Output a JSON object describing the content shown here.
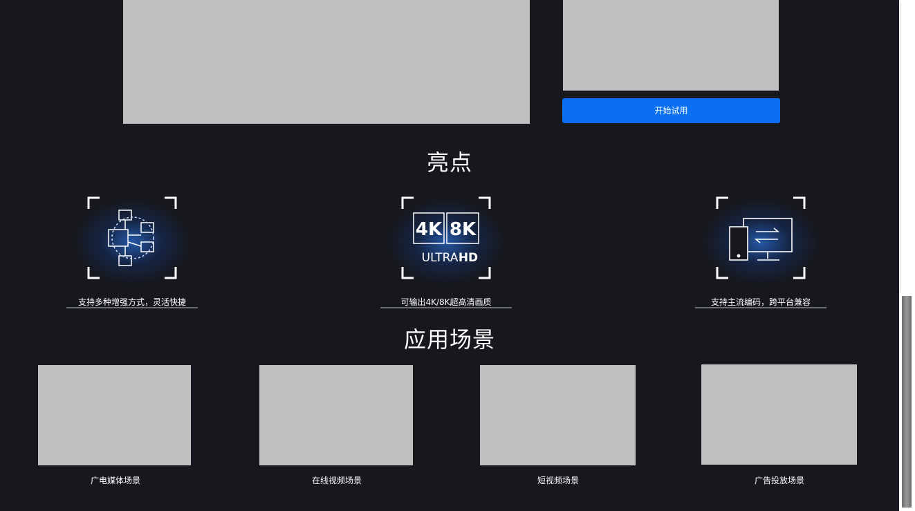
{
  "top": {
    "trial_button": "开始试用"
  },
  "highlights": {
    "title": "亮点",
    "items": [
      {
        "icon": "workflow-diagram-icon",
        "caption": "支持多种增强方式，灵活快捷"
      },
      {
        "icon": "4k-8k-ultrahd-icon",
        "caption": "可输出4K/8K超高清画质",
        "badge_4k": "4K",
        "badge_8k": "8K",
        "badge_ultra": "ULTRA",
        "badge_hd": "HD"
      },
      {
        "icon": "device-sync-icon",
        "caption": "支持主流编码，跨平台兼容"
      }
    ]
  },
  "scenarios": {
    "title": "应用场景",
    "items": [
      {
        "caption": "广电媒体场景"
      },
      {
        "caption": "在线视频场景"
      },
      {
        "caption": "短视频场景"
      },
      {
        "caption": "广告投放场景"
      }
    ]
  },
  "colors": {
    "background": "#16181e",
    "accent": "#0a6ff0",
    "placeholder": "#c0c0c0"
  }
}
